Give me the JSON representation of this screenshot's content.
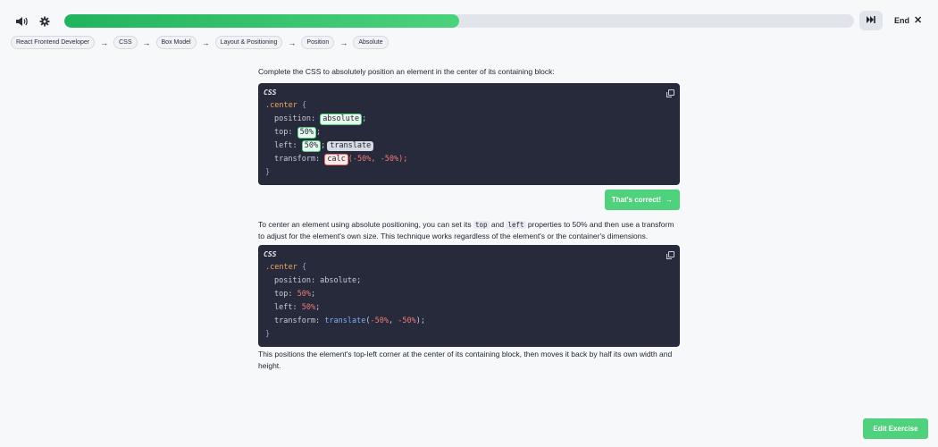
{
  "topbar": {
    "volume_icon": "speaker-icon",
    "settings_icon": "gear-icon",
    "progress": 0.5,
    "skip_icon": "fast-forward-icon",
    "end_label": "End",
    "end_icon": "close-icon"
  },
  "breadcrumb": [
    "React Frontend Developer",
    "CSS",
    "Box Model",
    "Layout & Positioning",
    "Position",
    "Absolute"
  ],
  "exercise": {
    "prompt": "Complete the CSS to absolutely position an element in the center of its containing block:",
    "code_lang": "CSS",
    "selector": ".center",
    "open_brace": "{",
    "close_brace": "}",
    "prop_position": "position:",
    "ans_position": "absolute",
    "prop_top": "top:",
    "ans_top": "50%",
    "prop_left": "left:",
    "ans_left": "50%",
    "chip_option": "translate",
    "prop_transform": "transform:",
    "ans_transform": "calc",
    "transform_args": "(-50%, -50%);",
    "semicolon": ";",
    "correct_label": "That's correct!",
    "correct_icon": "arrow-right-icon"
  },
  "explanation": {
    "text_1": "To center an element using absolute positioning, you can set its",
    "code_top": "top",
    "text_and": "and",
    "code_left": "left",
    "text_2": "properties to 50% and then use a transform to adjust for the element's own size. This technique works regardless of the element's or the container's dimensions.",
    "code_lang": "CSS",
    "selector": ".center",
    "open_brace": "{",
    "close_brace": "}",
    "line_position": "position: absolute;",
    "prop_top": "top:",
    "val_top": "50%",
    "prop_left": "left:",
    "val_left": "50%",
    "prop_transform": "transform:",
    "fn_translate": "translate",
    "paren_open": "(",
    "val_x": "-50%",
    "comma": ", ",
    "val_y": "-50%",
    "paren_close": ");",
    "semicolon": ";",
    "after_text": "This positions the element's top-left corner at the center of its containing block, then moves it back by half its own width and height."
  },
  "footer": {
    "edit_label": "Edit Exercise"
  },
  "colors": {
    "accent_green": "#4fd17e",
    "error_red": "#ee6e6e",
    "code_bg": "#262a3a"
  }
}
